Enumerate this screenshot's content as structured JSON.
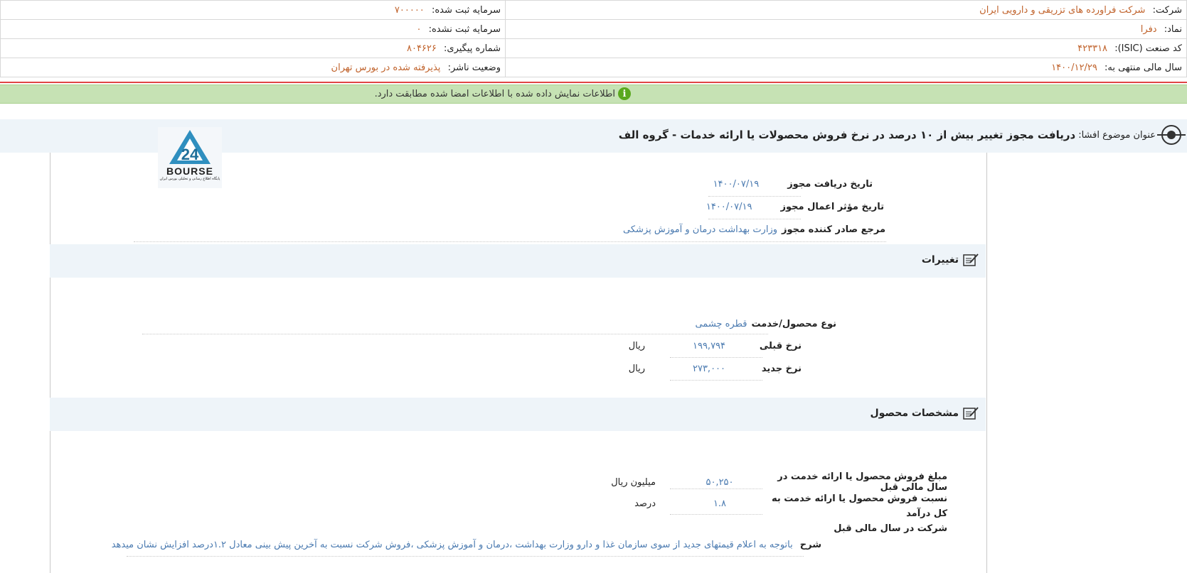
{
  "header": {
    "company_label": "شرکت:",
    "company_value": "شرکت فراورده های تزریقی و دارویی ایران",
    "symbol_label": "نماد:",
    "symbol_value": "دفرا",
    "isic_label": "کد صنعت (ISIC):",
    "isic_value": "۴۲۳۳۱۸",
    "fiscal_label": "سال مالی منتهی به:",
    "fiscal_value": "۱۴۰۰/۱۲/۲۹",
    "registered_capital_label": "سرمایه ثبت شده:",
    "registered_capital_value": "۷۰۰۰۰۰",
    "unregistered_capital_label": "سرمایه ثبت نشده:",
    "unregistered_capital_value": "۰",
    "tracking_label": "شماره پیگیری:",
    "tracking_value": "۸۰۴۶۲۶",
    "publisher_status_label": "وضعیت ناشر:",
    "publisher_status_value": "پذیرفته شده در بورس تهران"
  },
  "notice": {
    "icon": "info-icon",
    "text": "اطلاعات نمایش داده شده با اطلاعات امضا شده مطابقت دارد."
  },
  "subject": {
    "label": "عنوان موضوع افشا:",
    "title": "دریافت مجوز تغییر بیش از ۱۰ درصد در نرخ فروش محصولات یا ارائه خدمات - گروه الف"
  },
  "logo": {
    "text": "BOURSE",
    "subtext": "پایگاه اطلاع رسانی و تحلیلی بورس ایران"
  },
  "permit": {
    "receive_date_label": "تاریخ دریافت مجوز",
    "receive_date_value": "۱۴۰۰/۰۷/۱۹",
    "effective_date_label": "تاریخ مؤثر اعمال مجوز",
    "effective_date_value": "۱۴۰۰/۰۷/۱۹",
    "issuer_label": "مرجع صادر کننده مجوز",
    "issuer_value": "وزارت بهداشت درمان و آموزش پزشکی"
  },
  "changes": {
    "section_title": "تغییرات",
    "product_type_label": "نوع محصول/خدمت",
    "product_type_value": "قطره چشمی",
    "prev_rate_label": "نرخ قبلی",
    "prev_rate_value": "۱۹۹,۷۹۴",
    "prev_rate_unit": "ریال",
    "new_rate_label": "نرخ جدید",
    "new_rate_value": "۲۷۳,۰۰۰",
    "new_rate_unit": "ریال"
  },
  "specs": {
    "section_title": "مشخصات محصول",
    "sales_label": "مبلغ فروش محصول یا ارائه خدمت در سال مالی قبل",
    "sales_value": "۵۰,۲۵۰",
    "sales_unit": "میلیون ریال",
    "ratio_label_line1": "نسبت فروش محصول یا ارائه خدمت به کل درآمد",
    "ratio_label_line2": "شرکت در سال مالی قبل",
    "ratio_value": "۱.۸",
    "ratio_unit": "درصد",
    "desc_label": "شرح",
    "desc_value": "باتوجه به اعلام قیمتهای جدید از سوی سازمان غذا و دارو وزارت بهداشت ،درمان و آموزش پزشکی ،فروش شرکت نسبت به آخرین پیش بینی معادل ۱.۲درصد افزایش نشان میدهد"
  }
}
